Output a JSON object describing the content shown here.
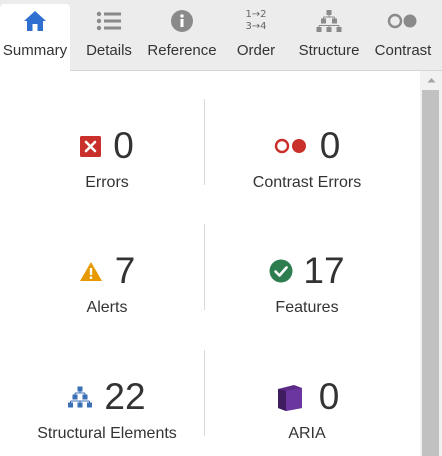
{
  "tabs": [
    {
      "label": "Summary",
      "icon": "home-icon",
      "active": true
    },
    {
      "label": "Details",
      "icon": "list-icon",
      "active": false
    },
    {
      "label": "Reference",
      "icon": "info-icon",
      "active": false
    },
    {
      "label": "Order",
      "icon": "order-icon",
      "active": false
    },
    {
      "label": "Structure",
      "icon": "structure-icon",
      "active": false
    },
    {
      "label": "Contrast",
      "icon": "contrast-icon",
      "active": false
    }
  ],
  "order_icon_text": {
    "top": "1→2",
    "bottom": "3→4"
  },
  "summary": {
    "errors": {
      "count": "0",
      "label": "Errors",
      "icon": "error-icon",
      "color": "#c9302c"
    },
    "contrast": {
      "count": "0",
      "label": "Contrast Errors",
      "icon": "contrast-error-icon",
      "color": "#c9302c"
    },
    "alerts": {
      "count": "7",
      "label": "Alerts",
      "icon": "alert-icon",
      "color": "#e69a00"
    },
    "features": {
      "count": "17",
      "label": "Features",
      "icon": "feature-icon",
      "color": "#2e7d4f"
    },
    "structure": {
      "count": "22",
      "label": "Structural Elements",
      "icon": "structure-icon",
      "color": "#3b6fb6"
    },
    "aria": {
      "count": "0",
      "label": "ARIA",
      "icon": "aria-icon",
      "color": "#5b2a86"
    }
  },
  "colors": {
    "accent": "#2e6fcf",
    "tab_bar": "#ececec",
    "tab_icon": "#8a8a8a"
  }
}
